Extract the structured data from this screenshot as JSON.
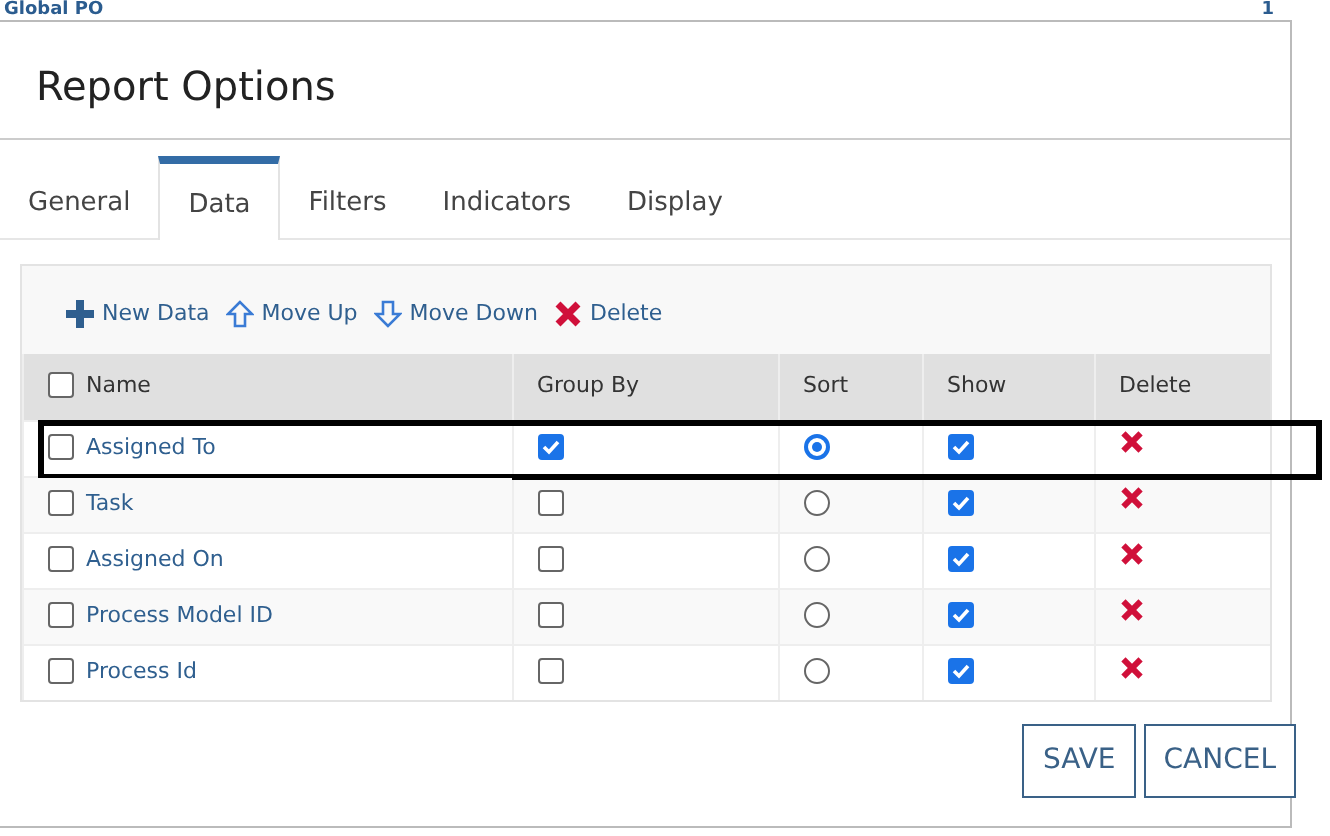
{
  "background": {
    "link": "Global PO",
    "count": "1"
  },
  "dialog": {
    "title": "Report Options",
    "tabs": [
      {
        "label": "General",
        "selected": false
      },
      {
        "label": "Data",
        "selected": true
      },
      {
        "label": "Filters",
        "selected": false
      },
      {
        "label": "Indicators",
        "selected": false
      },
      {
        "label": "Display",
        "selected": false
      }
    ],
    "toolbar": [
      {
        "kind": "add",
        "label": "New Data"
      },
      {
        "kind": "up",
        "label": "Move Up"
      },
      {
        "kind": "down",
        "label": "Move Down"
      },
      {
        "kind": "delete",
        "label": "Delete"
      }
    ],
    "table": {
      "select_all": false,
      "columns": [
        "Name",
        "Group By",
        "Sort",
        "Show",
        "Delete"
      ],
      "rows": [
        {
          "name": "Assigned To",
          "checked": false,
          "group_by": true,
          "sort": true,
          "show": true,
          "highlighted": true
        },
        {
          "name": "Task",
          "checked": false,
          "group_by": false,
          "sort": false,
          "show": true,
          "highlighted": false
        },
        {
          "name": "Assigned On",
          "checked": false,
          "group_by": false,
          "sort": false,
          "show": true,
          "highlighted": false
        },
        {
          "name": "Process Model ID",
          "checked": false,
          "group_by": false,
          "sort": false,
          "show": true,
          "highlighted": false
        },
        {
          "name": "Process Id",
          "checked": false,
          "group_by": false,
          "sort": false,
          "show": true,
          "highlighted": false
        }
      ]
    },
    "buttons": [
      "SAVE",
      "CANCEL"
    ]
  }
}
